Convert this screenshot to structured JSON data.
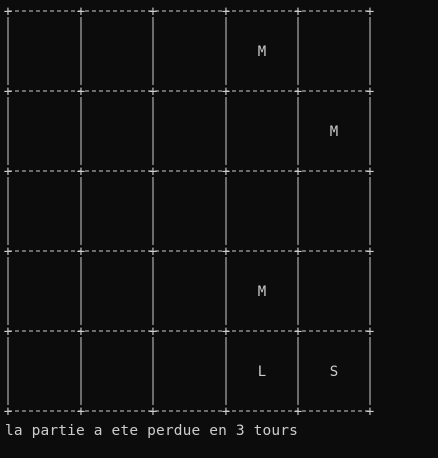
{
  "grid": {
    "rows": 5,
    "cols": 5,
    "cells": [
      [
        "",
        "",
        "",
        "M",
        ""
      ],
      [
        "",
        "",
        "",
        "",
        "M"
      ],
      [
        "",
        "",
        "",
        "",
        ""
      ],
      [
        "",
        "",
        "",
        "M",
        ""
      ],
      [
        "",
        "",
        "",
        "L",
        "S"
      ]
    ]
  },
  "status": {
    "message": "la partie a ete perdue en 3 tours"
  },
  "colors": {
    "background": "#0c0c0c",
    "foreground": "#cccccc"
  }
}
